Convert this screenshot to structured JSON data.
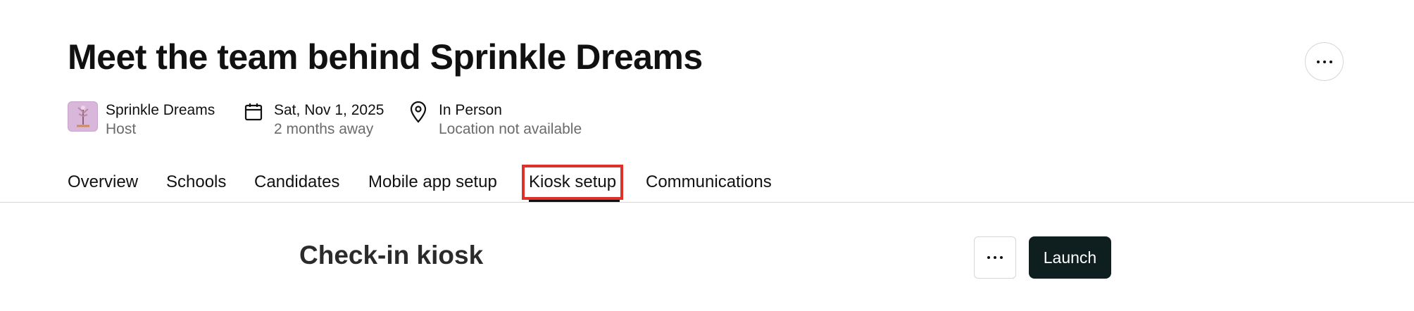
{
  "event": {
    "title": "Meet the team behind Sprinkle Dreams"
  },
  "meta": {
    "host": {
      "name": "Sprinkle Dreams",
      "role": "Host"
    },
    "date": {
      "main": "Sat, Nov 1, 2025",
      "sub": "2 months away"
    },
    "location": {
      "main": "In Person",
      "sub": "Location not available"
    }
  },
  "tabs": [
    {
      "label": "Overview"
    },
    {
      "label": "Schools"
    },
    {
      "label": "Candidates"
    },
    {
      "label": "Mobile app setup"
    },
    {
      "label": "Kiosk setup",
      "active": true
    },
    {
      "label": "Communications"
    }
  ],
  "section": {
    "title": "Check-in kiosk",
    "launch_label": "Launch"
  },
  "icons": {
    "more": "more-horizontal-icon",
    "calendar": "calendar-icon",
    "location": "map-pin-icon"
  },
  "colors": {
    "highlight": "#e0302a",
    "launch_bg": "#0f1f1f",
    "host_avatar": "#d9b7db"
  }
}
